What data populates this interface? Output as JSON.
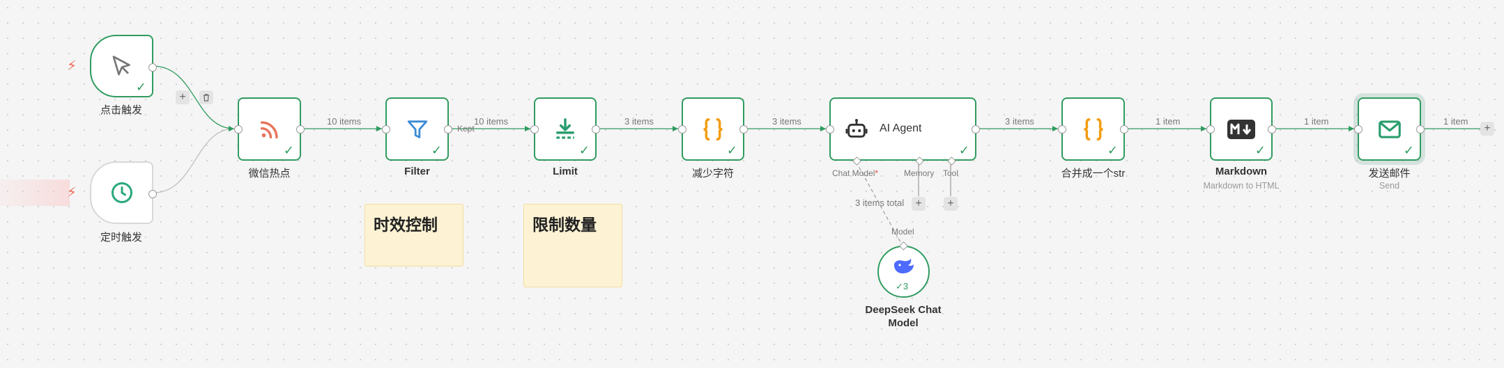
{
  "triggers": {
    "manual": {
      "label": "点击触发",
      "icon": "cursor-icon"
    },
    "schedule": {
      "label": "定时触发",
      "icon": "clock-icon"
    }
  },
  "nodes": {
    "rss": {
      "label": "微信热点",
      "icon": "rss-icon"
    },
    "filter": {
      "label": "Filter",
      "icon": "filter-icon",
      "output_label": "Kept"
    },
    "limit": {
      "label": "Limit",
      "icon": "limit-icon"
    },
    "reduce": {
      "label": "减少字符",
      "icon": "code-braces-icon"
    },
    "agent": {
      "label": "AI Agent",
      "icon": "robot-icon",
      "ports": {
        "chat_model": "Chat Model",
        "required_mark": "*",
        "memory": "Memory",
        "tool": "Tool"
      }
    },
    "merge": {
      "label": "合并成一个str",
      "icon": "code-braces-icon"
    },
    "markdown": {
      "label": "Markdown",
      "subtitle": "Markdown to HTML",
      "icon": "markdown-icon"
    },
    "email": {
      "label": "发送邮件",
      "subtitle": "Send",
      "icon": "mail-icon"
    },
    "deepseek": {
      "label_line1": "DeepSeek Chat",
      "label_line2": "Model",
      "icon": "whale-icon",
      "count": "3"
    }
  },
  "edges": {
    "rss_filter": "10 items",
    "filter_limit": "10 items",
    "limit_reduce": "3 items",
    "reduce_agent": "3 items",
    "agent_merge": "3 items",
    "merge_markdown": "1 item",
    "markdown_email": "1 item",
    "email_out": "1 item",
    "model_total": "3 items total",
    "model_port": "Model"
  },
  "stickies": {
    "s1": "时效控制",
    "s2": "限制数量"
  },
  "controls": {
    "plus": "+"
  },
  "colors": {
    "success": "#2f9b5f",
    "rss": "#e8735a",
    "filter": "#3b8bd4",
    "code": "#f39c12",
    "deepseek": "#4d6bfe",
    "trigger": "#ef6a5a"
  }
}
